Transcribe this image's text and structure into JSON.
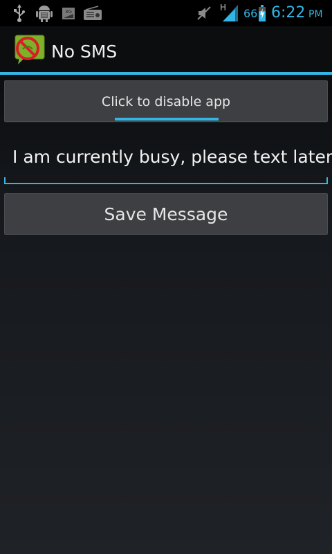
{
  "status_bar": {
    "icons": [
      "usb-icon",
      "android-debug-icon",
      "3g-icon",
      "radio-icon",
      "mute-icon",
      "signal-icon",
      "battery-icon"
    ],
    "network_type": "H",
    "battery_level": "66",
    "time": "6:22",
    "ampm": "PM",
    "accent_color": "#33b5e5"
  },
  "action_bar": {
    "title": "No SMS"
  },
  "toggle": {
    "label": "Click to disable app"
  },
  "message": {
    "value": "I am currently busy, please text later."
  },
  "save": {
    "label": "Save Message"
  }
}
